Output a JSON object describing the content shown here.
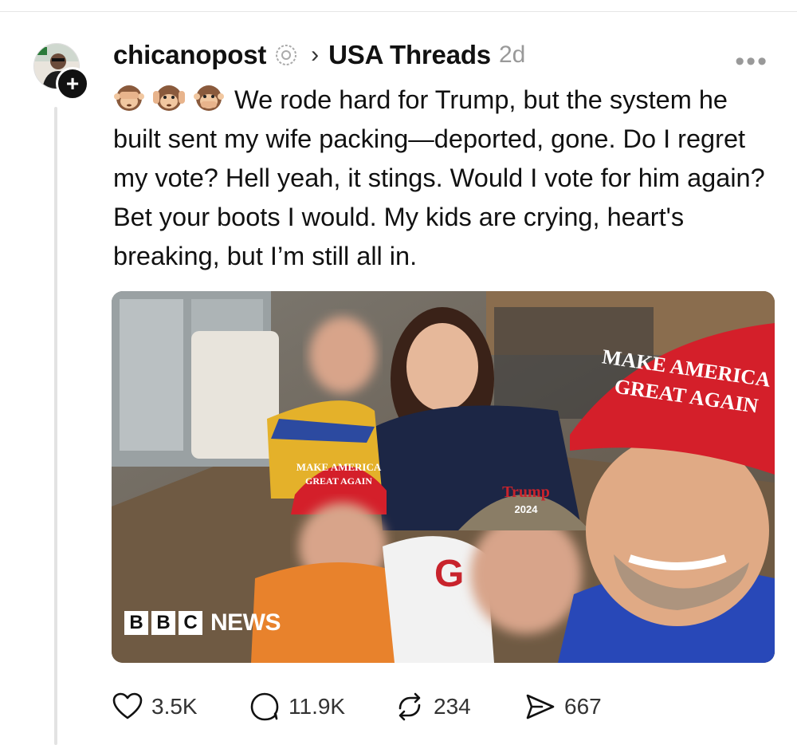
{
  "post": {
    "username": "chicanopost",
    "community": "USA Threads",
    "time": "2d",
    "text": "We rode hard for Trump, but the system he built sent my wife packing—deported, gone. Do I regret my vote? Hell yeah, it stings. Would I vote for him again? Bet your boots I would. My kids are crying, heart's breaking, but I’m still all in.",
    "emojis": [
      "see-no-evil-monkey",
      "hear-no-evil-monkey",
      "speak-no-evil-monkey"
    ]
  },
  "media": {
    "watermark_letters": [
      "B",
      "B",
      "C"
    ],
    "watermark_word": "NEWS",
    "hat_large": [
      "MAKE AMERICA",
      "GREAT AGAIN"
    ],
    "hat_child": [
      "MAKE AMERICA",
      "GREAT AGAIN"
    ],
    "hat_trump": [
      "Trump",
      "2024"
    ]
  },
  "actions": {
    "likes": "3.5K",
    "replies": "11.9K",
    "reposts": "234",
    "shares": "667"
  },
  "colors": {
    "text": "#111111",
    "muted": "#999999",
    "maga_red": "#d41f2a"
  }
}
